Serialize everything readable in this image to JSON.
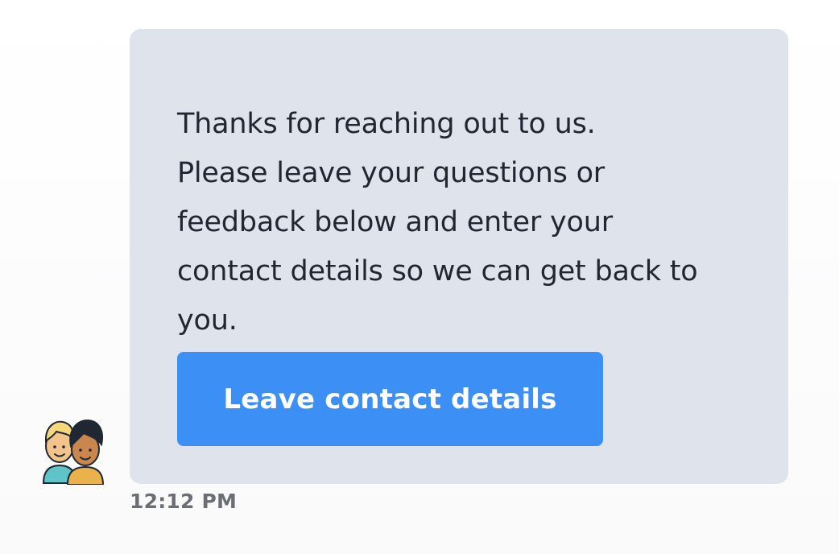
{
  "message": {
    "lines": [
      "Thanks for reaching out to us.",
      "Please leave your questions or",
      "feedback below and enter your",
      "contact details so we can get back to",
      "you."
    ],
    "button_label": "Leave contact details",
    "timestamp": "12:12 PM"
  },
  "avatar": {
    "icon": "support-team-avatar-icon"
  },
  "colors": {
    "bubble_bg": "#dfe3ec",
    "button_bg": "#3c8ff5",
    "text": "#1f2733",
    "timestamp": "#6b6f75"
  }
}
